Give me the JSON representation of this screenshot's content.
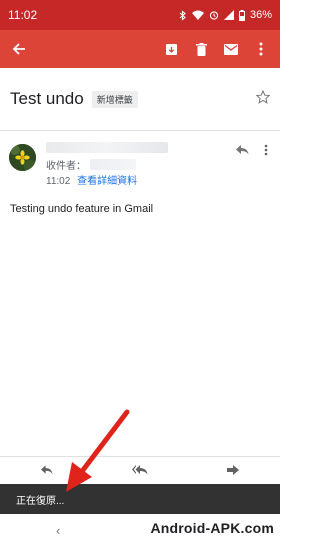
{
  "status_bar": {
    "time": "11:02",
    "battery": "36%"
  },
  "app_bar": {
    "icons": [
      "back-arrow-icon",
      "archive-icon",
      "delete-icon",
      "mark-unread-icon",
      "more-vert-icon"
    ],
    "accent": "#db4437",
    "status_color": "#c62828"
  },
  "message": {
    "subject": "Test undo",
    "label": "新增標籤",
    "recipient_prefix": "收件者：",
    "time": "11:02",
    "details_link": "查看詳細資料",
    "body": "Testing undo feature in Gmail"
  },
  "snackbar": {
    "text": "正在復原..."
  },
  "nav": {
    "back": "‹"
  },
  "watermark": {
    "text": "Android-APK.com"
  }
}
